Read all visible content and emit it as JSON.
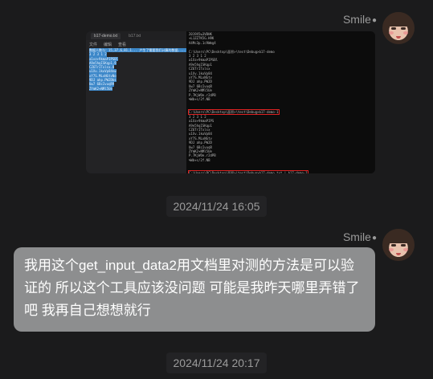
{
  "messages": [
    {
      "sender": "Smile",
      "type": "image",
      "screenshot": {
        "notepad": {
          "tab_title": "b17-demo.txt",
          "tab2": "b17.txt",
          "menu": [
            "文件",
            "编辑",
            "查看"
          ],
          "lines": [
            "数据人数与：15,37,6,81,1... 产生了需要我们计算的数据......",
            "3 2 3 1 2",
            "a1xz+9kmaPIPSBl",
            "A9e5hqISKqp1,9",
            "CZ6TrITxlsx.8",
            "u1Xv.1kuVp84nw",
            "xY7S.MLxNGtvNo",
            "9DJ ahp.PW2Dbs",
            "Uw7 6BcIvuqR9",
            "ZYmK2+NMl5Ue"
          ]
        },
        "console": [
          "2019X5w3VBHK",
          "+L1ZZ7K5G.H9K",
          "A4Mc3p.1c9Wmg4",
          "",
          "C:\\Users\\PC\\Desktop\\面积>\\test\\Debug>b17-demo",
          "3 2 3 1 2",
          "a1Xz+9kmaPIPSBl",
          "A9e5hqISKqp1",
          "CZ6TrITxlsx",
          "u1Xv.1kuVp84",
          "xY7S.MLxNGtv",
          "9DJ ahp.PW2D",
          "Uw7 6BcIvuqR",
          "ZYmK2+NMl5Ue",
          "P.7KjWOe.r2dPB",
          "%Wb+c/2f.NB",
          "",
          "",
          "C:\\Users\\PC\\Desktop\\面积>\\test\\Debug>b17-demo-1",
          "3 2 3 1 2",
          "a1Xz+9kmaPIPS",
          "A9e5hqISKqp1",
          "CZ6TrITxlsx",
          "u1Xv.1kuVp84",
          "xY7S.MLxNGtv",
          "9DJ ahp.PW2D",
          "Uw7 6BcIvuqR",
          "ZYmK2+NMl5Ue",
          "P.7KjWOe.r2dPB",
          "%Wb+c/2f.NB",
          "",
          "",
          "C:\\Users\\PC\\Desktop\\面积>\\test\\Debug>b17-demo.txt | b17-demo-1",
          "......"
        ],
        "console_highlight_lines": [
          18,
          32
        ]
      }
    },
    {
      "type": "timestamp",
      "text": "2024/11/24 16:05"
    },
    {
      "sender": "Smile",
      "type": "text",
      "text": "我用这个get_input_data2用文档里对测的方法是可以验证的 所以这个工具应该没问题 可能是我昨天哪里弄错了吧 我再自己想想就行"
    },
    {
      "type": "timestamp",
      "text": "2024/11/24 20:17"
    }
  ]
}
